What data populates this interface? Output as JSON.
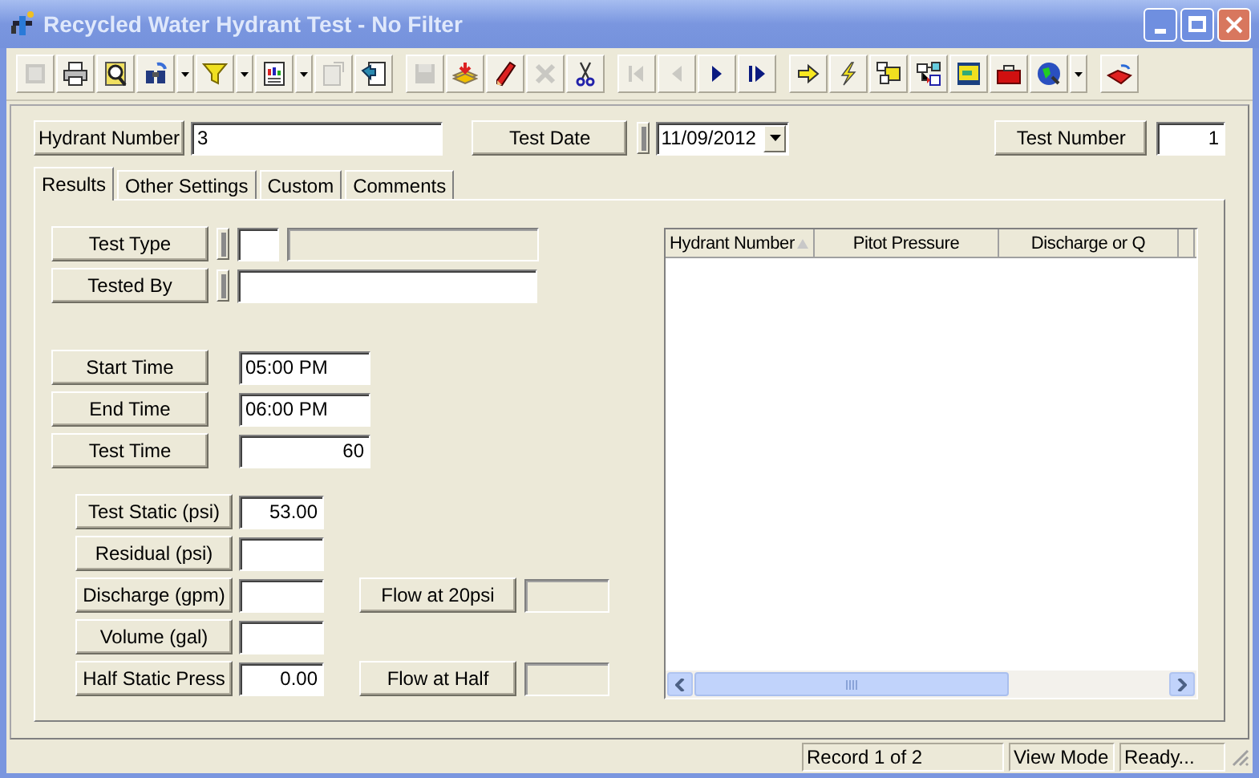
{
  "window": {
    "title": "Recycled Water Hydrant Test - No Filter"
  },
  "toolbar": [
    [
      {
        "kind": "blank",
        "disabled": true
      },
      {
        "kind": "print",
        "disabled": false
      },
      {
        "kind": "preview",
        "disabled": false
      },
      {
        "kind": "find",
        "disabled": false,
        "dropdown": true
      },
      {
        "kind": "filter",
        "disabled": false,
        "dropdown": true
      },
      {
        "kind": "report",
        "disabled": false,
        "dropdown": true
      },
      {
        "kind": "document",
        "disabled": true
      },
      {
        "kind": "export",
        "disabled": false
      }
    ],
    [
      {
        "kind": "save",
        "disabled": true
      },
      {
        "kind": "add",
        "disabled": false
      },
      {
        "kind": "edit",
        "disabled": false
      },
      {
        "kind": "delete",
        "disabled": true
      },
      {
        "kind": "cut",
        "disabled": false
      }
    ],
    [
      {
        "kind": "first",
        "disabled": true
      },
      {
        "kind": "previous",
        "disabled": true
      },
      {
        "kind": "next",
        "disabled": false
      },
      {
        "kind": "last",
        "disabled": false
      }
    ],
    [
      {
        "kind": "go",
        "disabled": false
      },
      {
        "kind": "lightning",
        "disabled": false
      },
      {
        "kind": "diagram",
        "disabled": false
      },
      {
        "kind": "linked",
        "disabled": false
      },
      {
        "kind": "map",
        "disabled": false
      },
      {
        "kind": "toolbox",
        "disabled": false
      },
      {
        "kind": "globe",
        "disabled": false,
        "dropdown": true
      }
    ],
    [
      {
        "kind": "exit",
        "disabled": false
      }
    ]
  ],
  "header": {
    "hydrant_number": {
      "label": "Hydrant Number",
      "value": "3"
    },
    "test_date": {
      "label": "Test Date",
      "value": "11/09/2012"
    },
    "test_number": {
      "label": "Test Number",
      "value": "1"
    }
  },
  "tabs": [
    {
      "label": "Results",
      "selected": true
    },
    {
      "label": "Other Settings",
      "selected": false
    },
    {
      "label": "Custom",
      "selected": false
    },
    {
      "label": "Comments",
      "selected": false
    }
  ],
  "lookups": [
    {
      "label": "Test Type",
      "kind": "code"
    },
    {
      "label": "Tested By",
      "kind": "text"
    }
  ],
  "times": [
    {
      "label": "Start Time",
      "value": "05:00 PM",
      "kind": "time"
    },
    {
      "label": "End Time",
      "value": "06:00 PM",
      "kind": "time"
    },
    {
      "label": "Test Time",
      "value": "60",
      "kind": "number"
    }
  ],
  "measurements": [
    {
      "label": "Test Static (psi)",
      "value": "53.00"
    },
    {
      "label": "Residual (psi)"
    },
    {
      "label": "Discharge (gpm)",
      "flow": {
        "label": "Flow at 20psi"
      }
    },
    {
      "label": "Volume  (gal)"
    },
    {
      "label": "Half Static Press",
      "value": "0.00",
      "flow": {
        "label": "Flow at Half"
      }
    }
  ],
  "grid": {
    "columns": [
      {
        "label": "Hydrant Number",
        "sorted": true
      },
      {
        "label": "Pitot Pressure",
        "sorted": false
      },
      {
        "label": "Discharge or Q",
        "sorted": false
      }
    ]
  },
  "status_bar": [
    "Record 1 of 2",
    "View Mode",
    "Ready..."
  ]
}
